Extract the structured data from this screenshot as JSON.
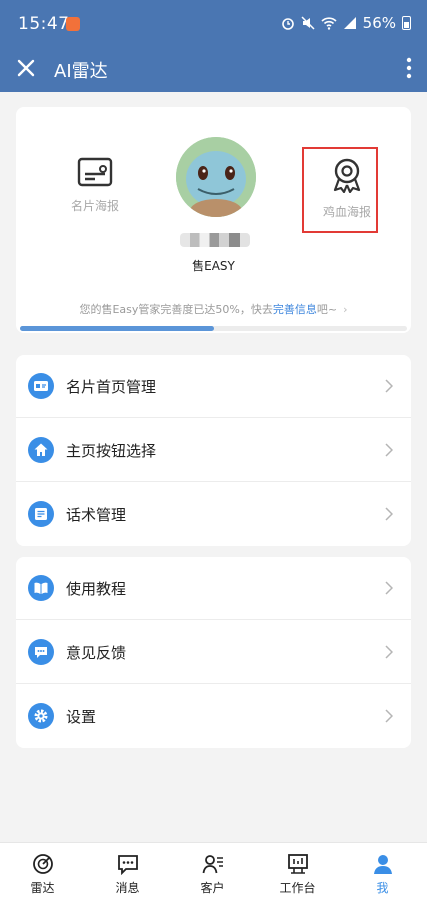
{
  "status_bar": {
    "time": "15:47",
    "battery": "56%"
  },
  "app_bar": {
    "title": "AI雷达",
    "close_icon": "close-icon",
    "more_icon": "more-vertical-icon"
  },
  "profile": {
    "left_action": {
      "label": "名片海报",
      "icon": "business-card-icon"
    },
    "right_action": {
      "label": "鸡血海报",
      "icon": "award-ribbon-icon"
    },
    "name": "售EASY",
    "completion": {
      "prefix": "您的售Easy管家完善度已达50%，快去",
      "link": "完善信息",
      "suffix": "吧~",
      "percent": 50
    }
  },
  "menu_groups": [
    {
      "items": [
        {
          "label": "名片首页管理",
          "icon": "card-icon"
        },
        {
          "label": "主页按钮选择",
          "icon": "home-icon"
        },
        {
          "label": "话术管理",
          "icon": "note-icon"
        }
      ]
    },
    {
      "items": [
        {
          "label": "使用教程",
          "icon": "book-icon"
        },
        {
          "label": "意见反馈",
          "icon": "chat-icon"
        },
        {
          "label": "设置",
          "icon": "gear-icon"
        }
      ]
    }
  ],
  "tabs": [
    {
      "label": "雷达",
      "icon": "radar-icon",
      "active": false
    },
    {
      "label": "消息",
      "icon": "message-icon",
      "active": false
    },
    {
      "label": "客户",
      "icon": "customer-icon",
      "active": false
    },
    {
      "label": "工作台",
      "icon": "workbench-icon",
      "active": false
    },
    {
      "label": "我",
      "icon": "user-icon",
      "active": true
    }
  ],
  "colors": {
    "brand": "#4a76b2",
    "accent": "#3a8ee6",
    "highlight": "#e23a35"
  }
}
